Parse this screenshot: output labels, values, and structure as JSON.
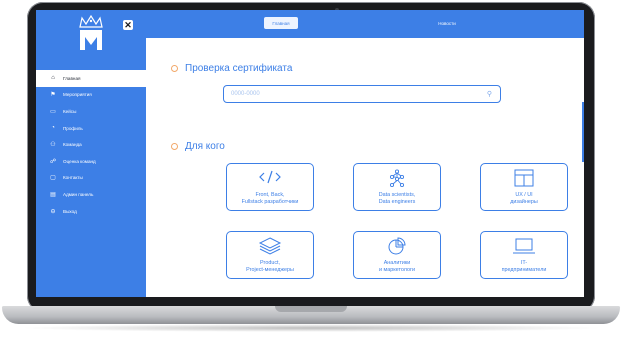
{
  "topbar": {
    "tabs": [
      {
        "label": "Главная"
      },
      {
        "label": "Новости"
      }
    ]
  },
  "sidebar": {
    "close_glyph": "✕",
    "items": [
      {
        "icon": "home-icon",
        "glyph": "⌂",
        "label": "Главная",
        "active": true
      },
      {
        "icon": "flag-icon",
        "glyph": "⚑",
        "label": "Мероприятия"
      },
      {
        "icon": "briefcase-icon",
        "glyph": "▭",
        "label": "Кейсы"
      },
      {
        "icon": "user-icon",
        "glyph": "◔",
        "label": "Профиль"
      },
      {
        "icon": "team-icon",
        "glyph": "⚇",
        "label": "Команда"
      },
      {
        "icon": "rating-icon",
        "glyph": "☍",
        "label": "Оценка команд"
      },
      {
        "icon": "contacts-icon",
        "glyph": "▢",
        "label": "Контакты"
      },
      {
        "icon": "admin-icon",
        "glyph": "▤",
        "label": "Админ панель"
      },
      {
        "icon": "logout-icon",
        "glyph": "⊖",
        "label": "Выход"
      }
    ]
  },
  "main": {
    "certificate_title": "Проверка сертификата",
    "search": {
      "placeholder": "0000-0000",
      "icon": "search-icon"
    },
    "audience_title": "Для кого",
    "cards": [
      {
        "icon": "code-icon",
        "label": "Front, Back,\nFullstack разработчики"
      },
      {
        "icon": "network-icon",
        "label": "Data scientists,\nData engineers"
      },
      {
        "icon": "layout-icon",
        "label": "UX / UI\nдизайнеры"
      },
      {
        "icon": "layers-icon",
        "label": "Product,\nProject-менеджеры"
      },
      {
        "icon": "pie-chart-icon",
        "label": "Аналитики\nи маркетологи"
      },
      {
        "icon": "laptop-icon",
        "label": "IT-\nпредприниматели"
      }
    ]
  },
  "colors": {
    "brand": "#3d7fe6",
    "accent_dot": "#f2a96b",
    "bezel": "#1a1b1e"
  }
}
